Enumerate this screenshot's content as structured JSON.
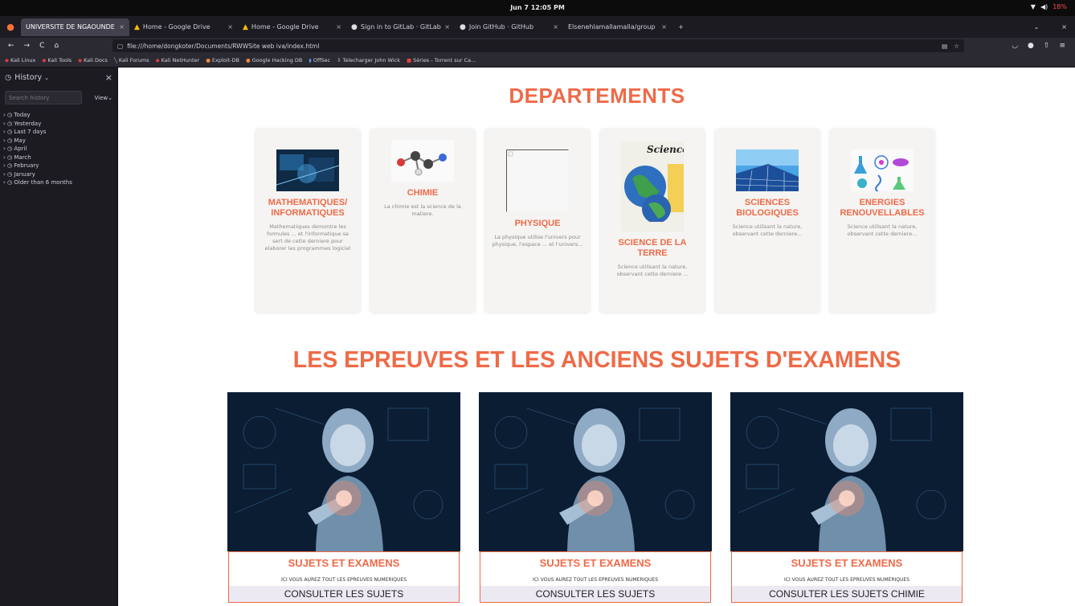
{
  "os": {
    "clock": "Jun 7  12:05 PM",
    "battery": "18%"
  },
  "browser": {
    "tabs": [
      {
        "label": "UNIVERSITE DE NGAOUNDE",
        "active": true
      },
      {
        "label": "Home - Google Drive",
        "active": false
      },
      {
        "label": "Home - Google Drive",
        "active": false
      },
      {
        "label": "Sign in to GitLab · GitLab",
        "active": false
      },
      {
        "label": "Join GitHub · GitHub",
        "active": false
      },
      {
        "label": "Elsenehlamallamalla/group",
        "active": false
      }
    ],
    "new_tab": "+",
    "url": "file:///home/dongkoter/Documents/RWWSite web iva/index.html",
    "bookmarks": [
      "Kali Linux",
      "Kali Tools",
      "Kali Docs",
      "Kali Forums",
      "Kali NetHunter",
      "Exploit-DB",
      "Google Hacking DB",
      "OffSec",
      "Telecharger John Wick",
      "Séries - Torrent sur Ca..."
    ]
  },
  "sidebar": {
    "title": "History",
    "search_placeholder": "Search history",
    "view_label": "View",
    "items": [
      "Today",
      "Yesterday",
      "Last 7 days",
      "May",
      "April",
      "March",
      "February",
      "January",
      "Older than 6 months"
    ]
  },
  "page": {
    "departments_title": "DEPARTEMENTS",
    "departments": [
      {
        "title": "MATHEMATIQUES/ INFORMATIQUES",
        "desc": "Mathematiques demontre les formules ... et l'informatique se sert de cette derniere pour elaborer les programmes logiciel"
      },
      {
        "title": "CHIMIE",
        "desc": "La chimie est la science de la matiere."
      },
      {
        "title": "PHYSIQUE",
        "desc": "La physique utilise l'univers pour physique, l'espace ... et l'univers..."
      },
      {
        "title": "SCIENCE DE LA TERRE",
        "desc": "Science utilisant la nature, observant cette derniere ...",
        "image_text": "Sciences"
      },
      {
        "title": "SCIENCES BIOLOGIQUES",
        "desc": "Science utilisant la nature, observant cette derniere..."
      },
      {
        "title": "ENERGIES RENOUVELLABLES",
        "desc": "Science utilisant la nature, observant cette derniere..."
      }
    ],
    "exams_title": "LES EPREUVES ET LES ANCIENS SUJETS D'EXAMENS",
    "exams": [
      {
        "title": "SUJETS ET EXAMENS",
        "sub": "ICI VOUS AUREZ TOUT LES EPREUVES NUMERIQUES",
        "button": "CONSULTER LES SUJETS"
      },
      {
        "title": "SUJETS ET EXAMENS",
        "sub": "ICI VOUS AUREZ TOUT LES EPREUVES NUMERIQUES",
        "button": "CONSULTER LES SUJETS"
      },
      {
        "title": "SUJETS ET EXAMENS",
        "sub": "ICI VOUS AUREZ TOUT LES EPREUVES NUMERIQUES",
        "button": "CONSULTER LES SUJETS CHIMIE"
      }
    ]
  }
}
